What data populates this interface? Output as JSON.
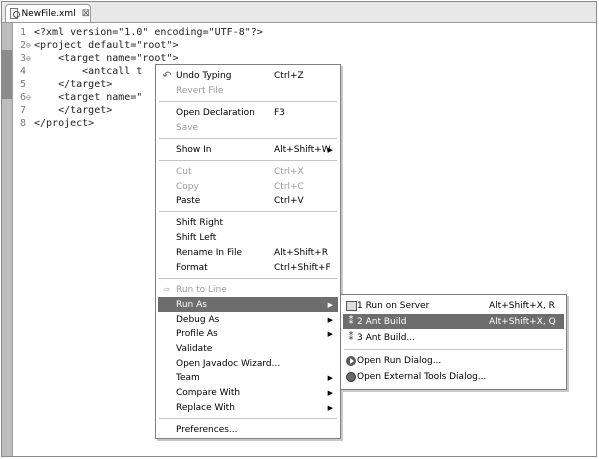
{
  "tab": {
    "title": "NewFile.xml",
    "close": "⊠"
  },
  "code_lines": [
    {
      "num": "1",
      "fold": "",
      "text": "<?xml version=\"1.0\" encoding=\"UTF-8\"?>"
    },
    {
      "num": "2",
      "fold": "⊖",
      "text": "<project default=\"root\">"
    },
    {
      "num": "3",
      "fold": "⊖",
      "text": "    <target name=\"root\">"
    },
    {
      "num": "4",
      "fold": "",
      "text": "        <antcall t"
    },
    {
      "num": "5",
      "fold": "",
      "text": "    </target>"
    },
    {
      "num": "6",
      "fold": "⊖",
      "text": "    <target name=\""
    },
    {
      "num": "7",
      "fold": "",
      "text": "    </target>"
    },
    {
      "num": "8",
      "fold": "",
      "text": "</project>"
    }
  ],
  "context_menu": {
    "undo_typing": {
      "label": "Undo Typing",
      "accel": "Ctrl+Z",
      "icon": "undo-icon"
    },
    "revert_file": {
      "label": "Revert File"
    },
    "open_declaration": {
      "label": "Open Declaration",
      "accel": "F3"
    },
    "save": {
      "label": "Save"
    },
    "show_in": {
      "label": "Show In",
      "accel": "Alt+Shift+W",
      "arrow": "▶"
    },
    "cut": {
      "label": "Cut",
      "accel": "Ctrl+X"
    },
    "copy": {
      "label": "Copy",
      "accel": "Ctrl+C"
    },
    "paste": {
      "label": "Paste",
      "accel": "Ctrl+V"
    },
    "shift_right": {
      "label": "Shift Right"
    },
    "shift_left": {
      "label": "Shift Left"
    },
    "rename_in_file": {
      "label": "Rename In File",
      "accel": "Alt+Shift+R"
    },
    "format": {
      "label": "Format",
      "accel": "Ctrl+Shift+F"
    },
    "run_to_line": {
      "label": "Run to Line",
      "icon": "run-to-line-icon"
    },
    "run_as": {
      "label": "Run As",
      "arrow": "▶"
    },
    "debug_as": {
      "label": "Debug As",
      "arrow": "▶"
    },
    "profile_as": {
      "label": "Profile As",
      "arrow": "▶"
    },
    "validate": {
      "label": "Validate"
    },
    "open_javadoc_wizard": {
      "label": "Open Javadoc Wizard..."
    },
    "team": {
      "label": "Team",
      "arrow": "▶"
    },
    "compare_with": {
      "label": "Compare With",
      "arrow": "▶"
    },
    "replace_with": {
      "label": "Replace With",
      "arrow": "▶"
    },
    "preferences": {
      "label": "Preferences..."
    }
  },
  "submenu": {
    "run_on_server": {
      "label": "1 Run on Server",
      "accel": "Alt+Shift+X, R",
      "icon": "server-icon"
    },
    "ant_build": {
      "label": "2 Ant Build",
      "accel": "Alt+Shift+X, Q",
      "icon": "ant-icon"
    },
    "ant_build_dialog": {
      "label": "3 Ant Build...",
      "icon": "ant-icon"
    },
    "open_run_dialog": {
      "label": "Open Run Dialog...",
      "icon": "run-icon"
    },
    "open_external_tools_dialog": {
      "label": "Open External Tools Dialog...",
      "icon": "external-tools-icon"
    }
  }
}
